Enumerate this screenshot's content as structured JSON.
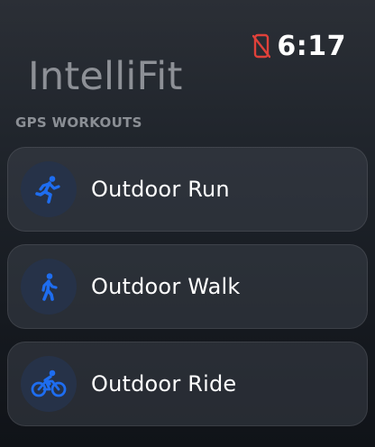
{
  "status": {
    "time": "6:17",
    "connection_icon": "phone-disconnected-icon",
    "connection_color": "#e0413a"
  },
  "app": {
    "title": "IntelliFit"
  },
  "section": {
    "label": "GPS WORKOUTS"
  },
  "workouts": [
    {
      "label": "Outdoor Run",
      "icon": "running-icon"
    },
    {
      "label": "Outdoor Walk",
      "icon": "walking-icon"
    },
    {
      "label": "Outdoor Ride",
      "icon": "cycling-icon"
    }
  ],
  "colors": {
    "accent": "#1e6df0",
    "icon_background": "#263248",
    "title_gray": "#8d9096"
  }
}
